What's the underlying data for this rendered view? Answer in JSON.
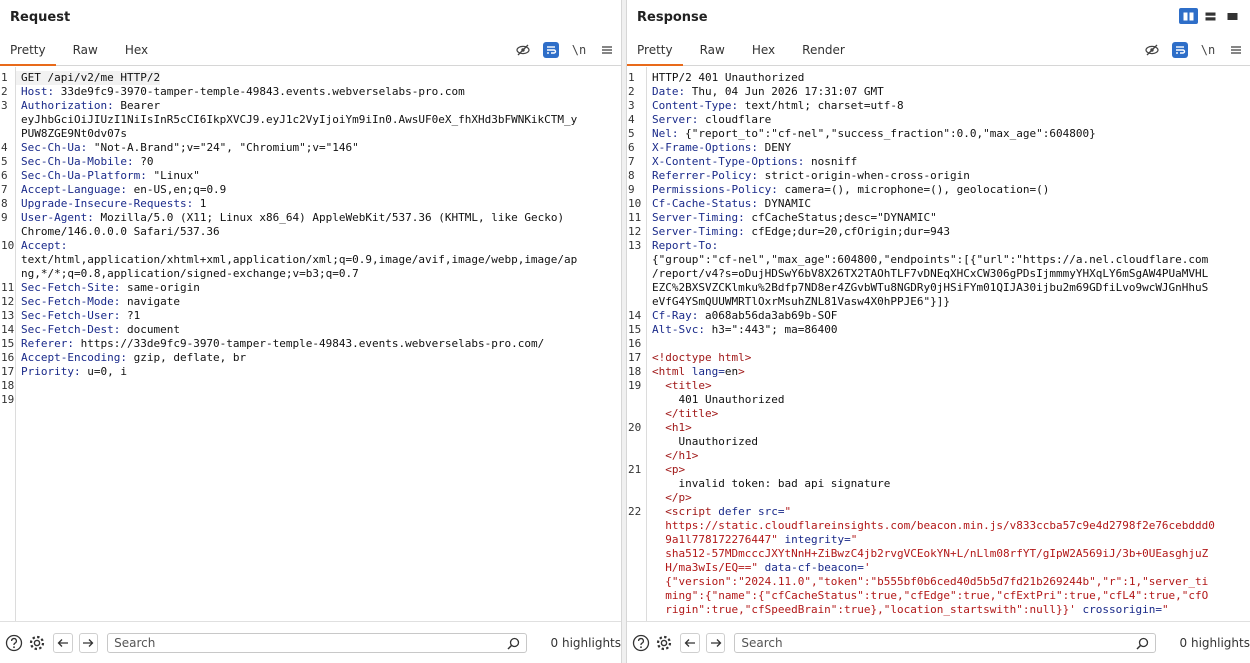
{
  "request": {
    "title": "Request",
    "tabs": [
      "Pretty",
      "Raw",
      "Hex"
    ],
    "newline_label": "\\n",
    "search_placeholder": "Search",
    "highlights": "0 highlights",
    "lines": [
      {
        "n": "1",
        "segs": [
          {
            "c": "",
            "t": "GET /api/v2/me HTTP/2"
          }
        ]
      },
      {
        "n": "2",
        "segs": [
          {
            "c": "hk",
            "t": "Host:"
          },
          {
            "c": "",
            "t": " 33de9fc9-3970-tamper-temple-49843.events.webverselabs-pro.com"
          }
        ]
      },
      {
        "n": "3",
        "segs": [
          {
            "c": "hk",
            "t": "Authorization:"
          },
          {
            "c": "",
            "t": " Bearer"
          }
        ]
      },
      {
        "n": "",
        "segs": [
          {
            "c": "",
            "t": "eyJhbGciOiJIUzI1NiIsInR5cCI6IkpXVCJ9.eyJ1c2VyIjoiYm9iIn0.AwsUF0eX_fhXHd3bFWNKikCTM_y"
          }
        ]
      },
      {
        "n": "",
        "segs": [
          {
            "c": "",
            "t": "PUW8ZGE9Nt0dv07s"
          }
        ]
      },
      {
        "n": "4",
        "segs": [
          {
            "c": "hk",
            "t": "Sec-Ch-Ua:"
          },
          {
            "c": "",
            "t": " \"Not-A.Brand\";v=\"24\", \"Chromium\";v=\"146\""
          }
        ]
      },
      {
        "n": "5",
        "segs": [
          {
            "c": "hk",
            "t": "Sec-Ch-Ua-Mobile:"
          },
          {
            "c": "",
            "t": " ?0"
          }
        ]
      },
      {
        "n": "6",
        "segs": [
          {
            "c": "hk",
            "t": "Sec-Ch-Ua-Platform:"
          },
          {
            "c": "",
            "t": " \"Linux\""
          }
        ]
      },
      {
        "n": "7",
        "segs": [
          {
            "c": "hk",
            "t": "Accept-Language:"
          },
          {
            "c": "",
            "t": " en-US,en;q=0.9"
          }
        ]
      },
      {
        "n": "8",
        "segs": [
          {
            "c": "hk",
            "t": "Upgrade-Insecure-Requests:"
          },
          {
            "c": "",
            "t": " 1"
          }
        ]
      },
      {
        "n": "9",
        "segs": [
          {
            "c": "hk",
            "t": "User-Agent:"
          },
          {
            "c": "",
            "t": " Mozilla/5.0 (X11; Linux x86_64) AppleWebKit/537.36 (KHTML, like Gecko)"
          }
        ]
      },
      {
        "n": "",
        "segs": [
          {
            "c": "",
            "t": "Chrome/146.0.0.0 Safari/537.36"
          }
        ]
      },
      {
        "n": "10",
        "segs": [
          {
            "c": "hk",
            "t": "Accept:"
          }
        ]
      },
      {
        "n": "",
        "segs": [
          {
            "c": "",
            "t": "text/html,application/xhtml+xml,application/xml;q=0.9,image/avif,image/webp,image/ap"
          }
        ]
      },
      {
        "n": "",
        "segs": [
          {
            "c": "",
            "t": "ng,*/*;q=0.8,application/signed-exchange;v=b3;q=0.7"
          }
        ]
      },
      {
        "n": "11",
        "segs": [
          {
            "c": "hk",
            "t": "Sec-Fetch-Site:"
          },
          {
            "c": "",
            "t": " same-origin"
          }
        ]
      },
      {
        "n": "12",
        "segs": [
          {
            "c": "hk",
            "t": "Sec-Fetch-Mode:"
          },
          {
            "c": "",
            "t": " navigate"
          }
        ]
      },
      {
        "n": "13",
        "segs": [
          {
            "c": "hk",
            "t": "Sec-Fetch-User:"
          },
          {
            "c": "",
            "t": " ?1"
          }
        ]
      },
      {
        "n": "14",
        "segs": [
          {
            "c": "hk",
            "t": "Sec-Fetch-Dest:"
          },
          {
            "c": "",
            "t": " document"
          }
        ]
      },
      {
        "n": "15",
        "segs": [
          {
            "c": "hk",
            "t": "Referer:"
          },
          {
            "c": "",
            "t": " https://33de9fc9-3970-tamper-temple-49843.events.webverselabs-pro.com/"
          }
        ]
      },
      {
        "n": "16",
        "segs": [
          {
            "c": "hk",
            "t": "Accept-Encoding:"
          },
          {
            "c": "",
            "t": " gzip, deflate, br"
          }
        ]
      },
      {
        "n": "17",
        "segs": [
          {
            "c": "hk",
            "t": "Priority:"
          },
          {
            "c": "",
            "t": " u=0, i"
          }
        ]
      },
      {
        "n": "18",
        "segs": []
      },
      {
        "n": "19",
        "segs": []
      }
    ]
  },
  "response": {
    "title": "Response",
    "tabs": [
      "Pretty",
      "Raw",
      "Hex",
      "Render"
    ],
    "newline_label": "\\n",
    "search_placeholder": "Search",
    "highlights": "0 highlights",
    "lines": [
      {
        "n": "1",
        "segs": [
          {
            "c": "",
            "t": "HTTP/2 401 Unauthorized"
          }
        ]
      },
      {
        "n": "2",
        "segs": [
          {
            "c": "hk",
            "t": "Date:"
          },
          {
            "c": "",
            "t": " Thu, 04 Jun 2026 17:31:07 GMT"
          }
        ]
      },
      {
        "n": "3",
        "segs": [
          {
            "c": "hk",
            "t": "Content-Type:"
          },
          {
            "c": "",
            "t": " text/html; charset=utf-8"
          }
        ]
      },
      {
        "n": "4",
        "segs": [
          {
            "c": "hk",
            "t": "Server:"
          },
          {
            "c": "",
            "t": " cloudflare"
          }
        ]
      },
      {
        "n": "5",
        "segs": [
          {
            "c": "hk",
            "t": "Nel:"
          },
          {
            "c": "",
            "t": " {\"report_to\":\"cf-nel\",\"success_fraction\":0.0,\"max_age\":604800}"
          }
        ]
      },
      {
        "n": "6",
        "segs": [
          {
            "c": "hk",
            "t": "X-Frame-Options:"
          },
          {
            "c": "",
            "t": " DENY"
          }
        ]
      },
      {
        "n": "7",
        "segs": [
          {
            "c": "hk",
            "t": "X-Content-Type-Options:"
          },
          {
            "c": "",
            "t": " nosniff"
          }
        ]
      },
      {
        "n": "8",
        "segs": [
          {
            "c": "hk",
            "t": "Referrer-Policy:"
          },
          {
            "c": "",
            "t": " strict-origin-when-cross-origin"
          }
        ]
      },
      {
        "n": "9",
        "segs": [
          {
            "c": "hk",
            "t": "Permissions-Policy:"
          },
          {
            "c": "",
            "t": " camera=(), microphone=(), geolocation=()"
          }
        ]
      },
      {
        "n": "10",
        "segs": [
          {
            "c": "hk",
            "t": "Cf-Cache-Status:"
          },
          {
            "c": "",
            "t": " DYNAMIC"
          }
        ]
      },
      {
        "n": "11",
        "segs": [
          {
            "c": "hk",
            "t": "Server-Timing:"
          },
          {
            "c": "",
            "t": " cfCacheStatus;desc=\"DYNAMIC\""
          }
        ]
      },
      {
        "n": "12",
        "segs": [
          {
            "c": "hk",
            "t": "Server-Timing:"
          },
          {
            "c": "",
            "t": " cfEdge;dur=20,cfOrigin;dur=943"
          }
        ]
      },
      {
        "n": "13",
        "segs": [
          {
            "c": "hk",
            "t": "Report-To:"
          }
        ]
      },
      {
        "n": "",
        "segs": [
          {
            "c": "",
            "t": "{\"group\":\"cf-nel\",\"max_age\":604800,\"endpoints\":[{\"url\":\"https://a.nel.cloudflare.com"
          }
        ]
      },
      {
        "n": "",
        "segs": [
          {
            "c": "",
            "t": "/report/v4?s=oDujHDSwY6bV8X26TX2TAOhTLF7vDNEqXHCxCW306gPDsIjmmmyYHXqLY6mSgAW4PUaMVHL"
          }
        ]
      },
      {
        "n": "",
        "segs": [
          {
            "c": "",
            "t": "EZC%2BXSVZCKlmku%2Bdfp7ND8er4ZGvbWTu8NGDRy0jHSiFYm01QIJA30ijbu2m69GDfiLvo9wcWJGnHhuS"
          }
        ]
      },
      {
        "n": "",
        "segs": [
          {
            "c": "",
            "t": "eVfG4YSmQUUWMRTlOxrMsuhZNL81Vasw4X0hPPJE6\"}]}"
          }
        ]
      },
      {
        "n": "14",
        "segs": [
          {
            "c": "hk",
            "t": "Cf-Ray:"
          },
          {
            "c": "",
            "t": " a068ab56da3ab69b-SOF"
          }
        ]
      },
      {
        "n": "15",
        "segs": [
          {
            "c": "hk",
            "t": "Alt-Svc:"
          },
          {
            "c": "",
            "t": " h3=\":443\"; ma=86400"
          }
        ]
      },
      {
        "n": "16",
        "segs": []
      },
      {
        "n": "17",
        "segs": [
          {
            "c": "tag",
            "t": "<!doctype html>"
          }
        ]
      },
      {
        "n": "18",
        "segs": [
          {
            "c": "tag",
            "t": "<html "
          },
          {
            "c": "attr",
            "t": "lang="
          },
          {
            "c": "",
            "t": "en"
          },
          {
            "c": "tag",
            "t": ">"
          }
        ]
      },
      {
        "n": "19",
        "segs": [
          {
            "c": "",
            "t": "  "
          },
          {
            "c": "tag",
            "t": "<title>"
          }
        ]
      },
      {
        "n": "",
        "segs": [
          {
            "c": "",
            "t": "    401 Unauthorized"
          }
        ]
      },
      {
        "n": "",
        "segs": [
          {
            "c": "",
            "t": "  "
          },
          {
            "c": "tag",
            "t": "</title>"
          }
        ]
      },
      {
        "n": "20",
        "segs": [
          {
            "c": "",
            "t": "  "
          },
          {
            "c": "tag",
            "t": "<h1>"
          }
        ]
      },
      {
        "n": "",
        "segs": [
          {
            "c": "",
            "t": "    Unauthorized"
          }
        ]
      },
      {
        "n": "",
        "segs": [
          {
            "c": "",
            "t": "  "
          },
          {
            "c": "tag",
            "t": "</h1>"
          }
        ]
      },
      {
        "n": "21",
        "segs": [
          {
            "c": "",
            "t": "  "
          },
          {
            "c": "tag",
            "t": "<p>"
          }
        ]
      },
      {
        "n": "",
        "segs": [
          {
            "c": "",
            "t": "    invalid token: bad api signature"
          }
        ]
      },
      {
        "n": "",
        "segs": [
          {
            "c": "",
            "t": "  "
          },
          {
            "c": "tag",
            "t": "</p>"
          }
        ]
      },
      {
        "n": "22",
        "segs": [
          {
            "c": "",
            "t": "  "
          },
          {
            "c": "tag",
            "t": "<script "
          },
          {
            "c": "attr",
            "t": "defer src="
          },
          {
            "c": "str",
            "t": "\""
          }
        ]
      },
      {
        "n": "",
        "segs": [
          {
            "c": "str",
            "t": "  https://static.cloudflareinsights.com/beacon.min.js/v833ccba57c9e4d2798f2e76cebddd0"
          }
        ]
      },
      {
        "n": "",
        "segs": [
          {
            "c": "str",
            "t": "  9a1l778172276447\""
          },
          {
            "c": "attr",
            "t": " integrity="
          },
          {
            "c": "str",
            "t": "\""
          }
        ]
      },
      {
        "n": "",
        "segs": [
          {
            "c": "str",
            "t": "  sha512-57MDmcccJXYtNnH+ZiBwzC4jb2rvgVCEokYN+L/nLlm08rfYT/gIpW2A569iJ/3b+0UEasghjuZ"
          }
        ]
      },
      {
        "n": "",
        "segs": [
          {
            "c": "str",
            "t": "  H/ma3wIs/EQ==\""
          },
          {
            "c": "attr",
            "t": " data-cf-beacon="
          },
          {
            "c": "str",
            "t": "'"
          }
        ]
      },
      {
        "n": "",
        "segs": [
          {
            "c": "str",
            "t": "  {\"version\":\"2024.11.0\",\"token\":\"b555bf0b6ced40d5b5d7fd21b269244b\",\"r\":1,\"server_ti"
          }
        ]
      },
      {
        "n": "",
        "segs": [
          {
            "c": "str",
            "t": "  ming\":{\"name\":{\"cfCacheStatus\":true,\"cfEdge\":true,\"cfExtPri\":true,\"cfL4\":true,\"cfO"
          }
        ]
      },
      {
        "n": "",
        "segs": [
          {
            "c": "str",
            "t": "  rigin\":true,\"cfSpeedBrain\":true},\"location_startswith\":null}}'"
          },
          {
            "c": "attr",
            "t": " crossorigin="
          },
          {
            "c": "str",
            "t": "\""
          }
        ]
      }
    ]
  }
}
